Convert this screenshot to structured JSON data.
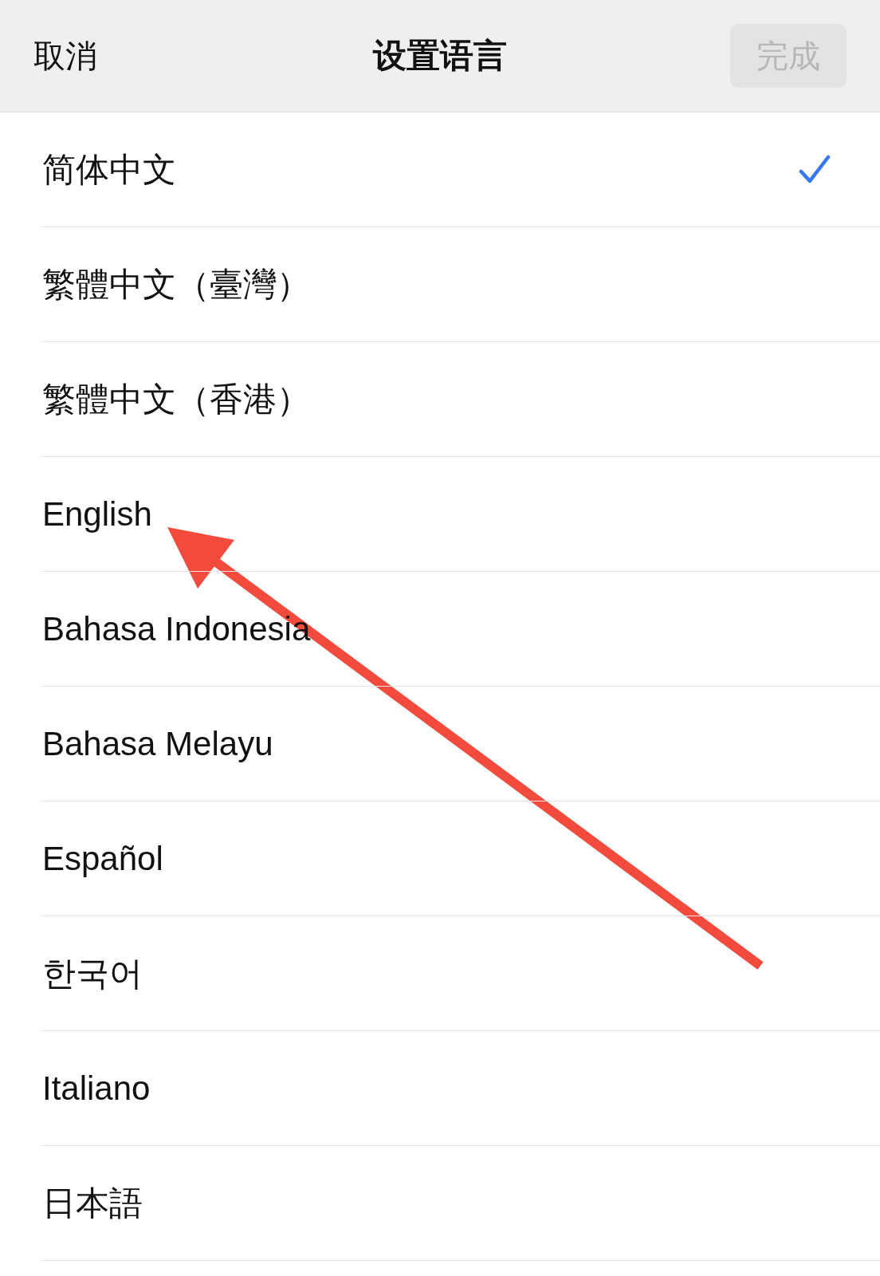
{
  "nav_bar": {
    "cancel": "取消",
    "title": "设置语言",
    "done": {
      "label": "完成",
      "disabled": true
    }
  },
  "languages": [
    {
      "label": "简体中文",
      "selected": true
    },
    {
      "label": "繁體中文（臺灣）",
      "selected": false
    },
    {
      "label": "繁體中文（香港）",
      "selected": false
    },
    {
      "label": "English",
      "selected": false
    },
    {
      "label": "Bahasa Indonesia",
      "selected": false
    },
    {
      "label": "Bahasa Melayu",
      "selected": false
    },
    {
      "label": "Español",
      "selected": false
    },
    {
      "label": "한국어",
      "selected": false
    },
    {
      "label": "Italiano",
      "selected": false
    },
    {
      "label": "日本語",
      "selected": false
    }
  ]
}
